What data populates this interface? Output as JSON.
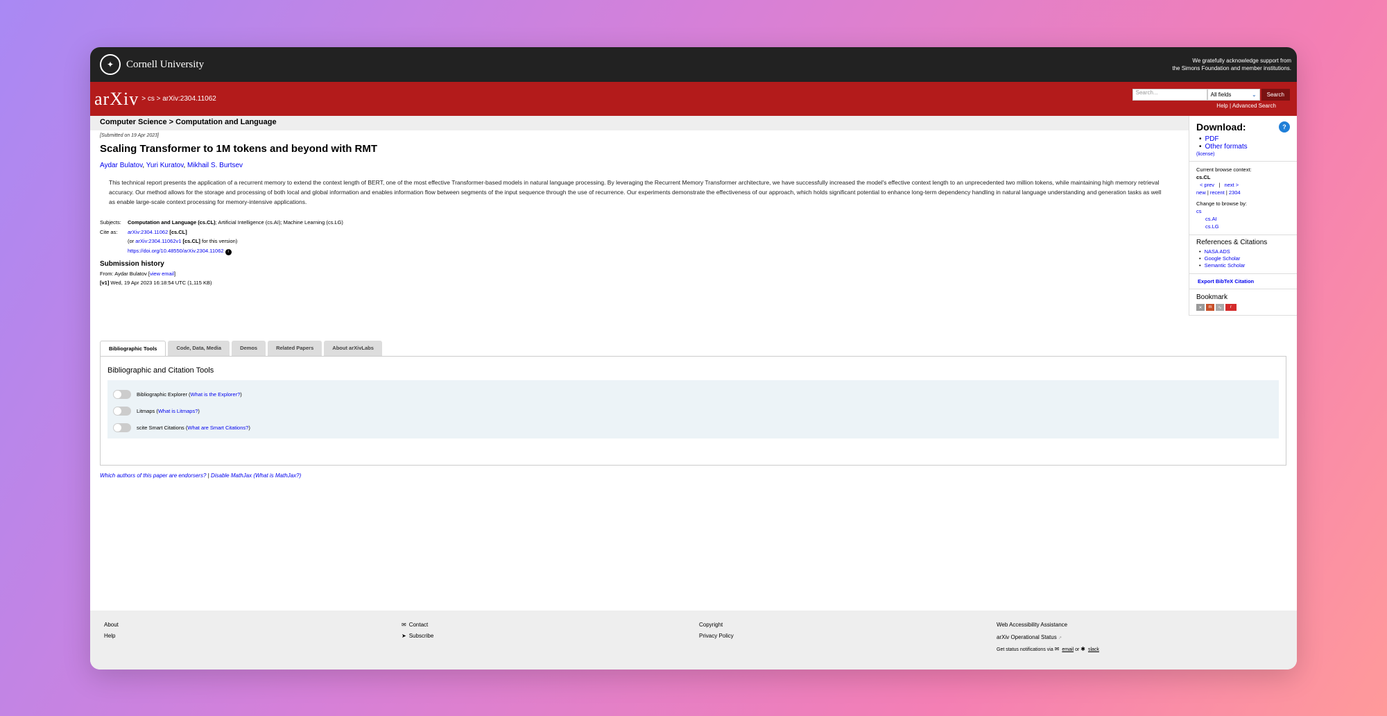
{
  "cornell": {
    "name": "Cornell University",
    "support_line1": "We gratefully acknowledge support from",
    "support_line2": "the Simons Foundation and member institutions."
  },
  "arxiv_header": {
    "logo": "arXiv",
    "breadcrumb": "> cs > arXiv:2304.11062",
    "search_placeholder": "Search...",
    "search_field": "All fields",
    "search_button": "Search",
    "help": "Help",
    "advanced": "Advanced Search"
  },
  "subheader": "Computer Science > Computation and Language",
  "article": {
    "submitted": "[Submitted on 19 Apr 2023]",
    "title": "Scaling Transformer to 1M tokens and beyond with RMT",
    "authors": [
      "Aydar Bulatov",
      "Yuri Kuratov",
      "Mikhail S. Burtsev"
    ],
    "abstract": "This technical report presents the application of a recurrent memory to extend the context length of BERT, one of the most effective Transformer-based models in natural language processing. By leveraging the Recurrent Memory Transformer architecture, we have successfully increased the model's effective context length to an unprecedented two million tokens, while maintaining high memory retrieval accuracy. Our method allows for the storage and processing of both local and global information and enables information flow between segments of the input sequence through the use of recurrence. Our experiments demonstrate the effectiveness of our approach, which holds significant potential to enhance long-term dependency handling in natural language understanding and generation tasks as well as enable large-scale context processing for memory-intensive applications.",
    "subjects_label": "Subjects:",
    "subjects_primary": "Computation and Language (cs.CL)",
    "subjects_rest": "; Artificial Intelligence (cs.AI); Machine Learning (cs.LG)",
    "cite_label": "Cite as:",
    "cite_id": "arXiv:2304.11062",
    "cite_cat": "[cs.CL]",
    "cite_v_prefix": "(or ",
    "cite_v_id": "arXiv:2304.11062v1",
    "cite_v_cat": "[cs.CL]",
    "cite_v_suffix": " for this version)",
    "doi": "https://doi.org/10.48550/arXiv.2304.11062",
    "history_title": "Submission history",
    "history_from": "From: Aydar Bulatov [",
    "history_email": "view email",
    "history_from_end": "]",
    "history_v": "[v1]",
    "history_v_detail": " Wed, 19 Apr 2023 16:18:54 UTC (1,115 KB)"
  },
  "tabs": [
    "Bibliographic Tools",
    "Code, Data, Media",
    "Demos",
    "Related Papers",
    "About arXivLabs"
  ],
  "tools": {
    "title": "Bibliographic and Citation Tools",
    "items": [
      {
        "label": "Bibliographic Explorer (",
        "link": "What is the Explorer?",
        "end": ")"
      },
      {
        "label": "Litmaps (",
        "link": "What is Litmaps?",
        "end": ")"
      },
      {
        "label": "scite Smart Citations (",
        "link": "What are Smart Citations?",
        "end": ")"
      }
    ]
  },
  "endorsers": {
    "link1": "Which authors of this paper are endorsers?",
    "sep": " | ",
    "link2": "Disable MathJax",
    "link3": "(What is MathJax?)"
  },
  "sidebar": {
    "download_title": "Download:",
    "pdf": "PDF",
    "other": "Other formats",
    "license": "(license)",
    "context_label": "Current browse context:",
    "context": "cs.CL",
    "prev": "< prev",
    "pipe": "|",
    "next": "next >",
    "new": "new",
    "recent": "recent",
    "date": "2304",
    "change_label": "Change to browse by:",
    "browse": [
      "cs",
      "cs.AI",
      "cs.LG"
    ],
    "refs_title": "References & Citations",
    "refs": [
      "NASA ADS",
      "Google Scholar",
      "Semantic Scholar"
    ],
    "export": "Export BibTeX Citation",
    "bookmark": "Bookmark"
  },
  "footer": {
    "about": "About",
    "help": "Help",
    "contact": "Contact",
    "subscribe": "Subscribe",
    "copyright": "Copyright",
    "privacy": "Privacy Policy",
    "accessibility": "Web Accessibility Assistance",
    "status": "arXiv Operational Status",
    "notify_prefix": "Get status notifications via",
    "email": "email",
    "or": "or",
    "slack": "slack"
  }
}
